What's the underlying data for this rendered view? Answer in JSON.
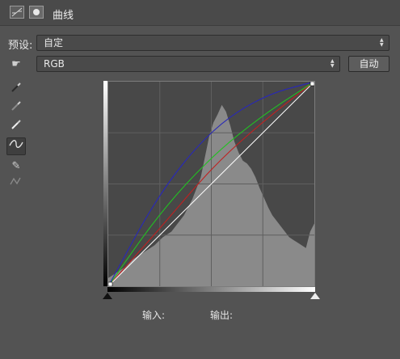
{
  "panel": {
    "title": "曲线",
    "icons": [
      "curves-adjustment-icon",
      "layer-mask-icon"
    ]
  },
  "preset": {
    "label": "预设:",
    "value": "自定"
  },
  "channel": {
    "value": "RGB",
    "auto_label": "自动"
  },
  "tools": [
    {
      "name": "hand-targeted-adjust-icon",
      "glyph": "☛"
    },
    {
      "name": "black-eyedropper-icon",
      "glyph": "⁄"
    },
    {
      "name": "gray-eyedropper-icon",
      "glyph": "⁄"
    },
    {
      "name": "white-eyedropper-icon",
      "glyph": "⁄"
    },
    {
      "name": "curve-edit-points-icon",
      "glyph": "∿"
    },
    {
      "name": "pencil-draw-icon",
      "glyph": "✎"
    },
    {
      "name": "smooth-curve-icon",
      "glyph": "≈"
    }
  ],
  "readout": {
    "input_label": "输入:",
    "output_label": "输出:"
  },
  "curves": {
    "range": [
      0,
      255
    ],
    "rgb": [
      [
        0,
        0
      ],
      [
        255,
        255
      ]
    ],
    "red": [
      [
        0,
        0
      ],
      [
        64,
        72
      ],
      [
        128,
        148
      ],
      [
        192,
        206
      ],
      [
        255,
        255
      ]
    ],
    "green": [
      [
        0,
        0
      ],
      [
        64,
        92
      ],
      [
        128,
        162
      ],
      [
        192,
        214
      ],
      [
        255,
        255
      ]
    ],
    "blue": [
      [
        0,
        0
      ],
      [
        64,
        118
      ],
      [
        128,
        196
      ],
      [
        192,
        238
      ],
      [
        255,
        255
      ]
    ],
    "colors": {
      "rgb": "#ffffff",
      "red": "#c02020",
      "green": "#22c022",
      "blue": "#2828b8"
    }
  },
  "histogram": [
    6,
    8,
    10,
    12,
    14,
    17,
    20,
    22,
    24,
    26,
    28,
    30,
    33,
    36,
    38,
    40,
    44,
    48,
    52,
    58,
    64,
    72,
    80,
    95,
    110,
    120,
    126,
    133,
    128,
    118,
    106,
    98,
    92,
    90,
    86,
    80,
    72,
    65,
    58,
    52,
    48,
    44,
    40,
    36,
    34,
    32,
    30,
    28,
    40,
    46
  ]
}
